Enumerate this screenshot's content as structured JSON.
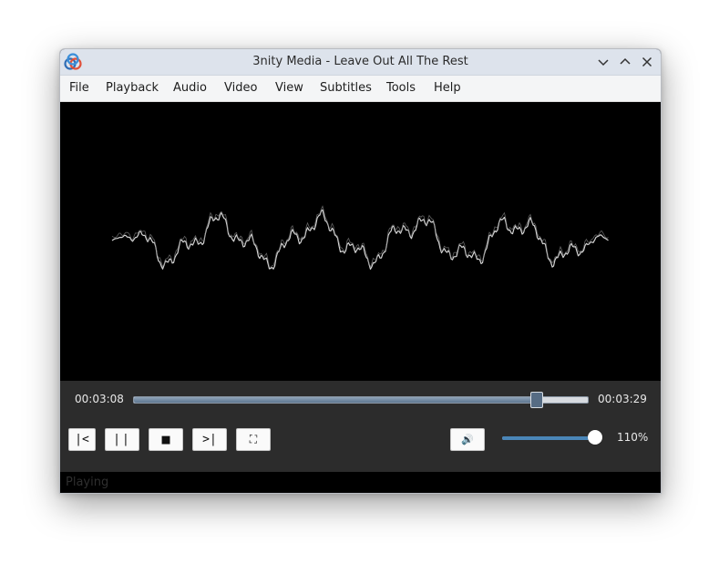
{
  "window": {
    "title": "3nity Media - Leave Out All The Rest"
  },
  "menu": [
    "File",
    "Playback",
    "Audio",
    "Video",
    "View",
    "Subtitles",
    "Tools",
    "Help"
  ],
  "playback": {
    "elapsed": "00:03:08",
    "total": "00:03:29",
    "progress": 0.887
  },
  "buttons": {
    "previous": "|<",
    "pause": "||",
    "stop": "■",
    "next": ">|",
    "fullscreen": "⛶",
    "mute": "🔊"
  },
  "volume": {
    "label": "110%",
    "level": 0.94
  },
  "status": {
    "text": "Playing"
  },
  "colors": {
    "title_bar": "#dde3ec",
    "controls_bg": "#2c2c2c",
    "seek_knob": "#566c84",
    "volume_fill": "#4a86b8"
  },
  "icons": {
    "app": "3nity-logo-icon",
    "minimize": "chevron-down-icon",
    "maximize": "chevron-up-icon",
    "close": "close-icon"
  }
}
